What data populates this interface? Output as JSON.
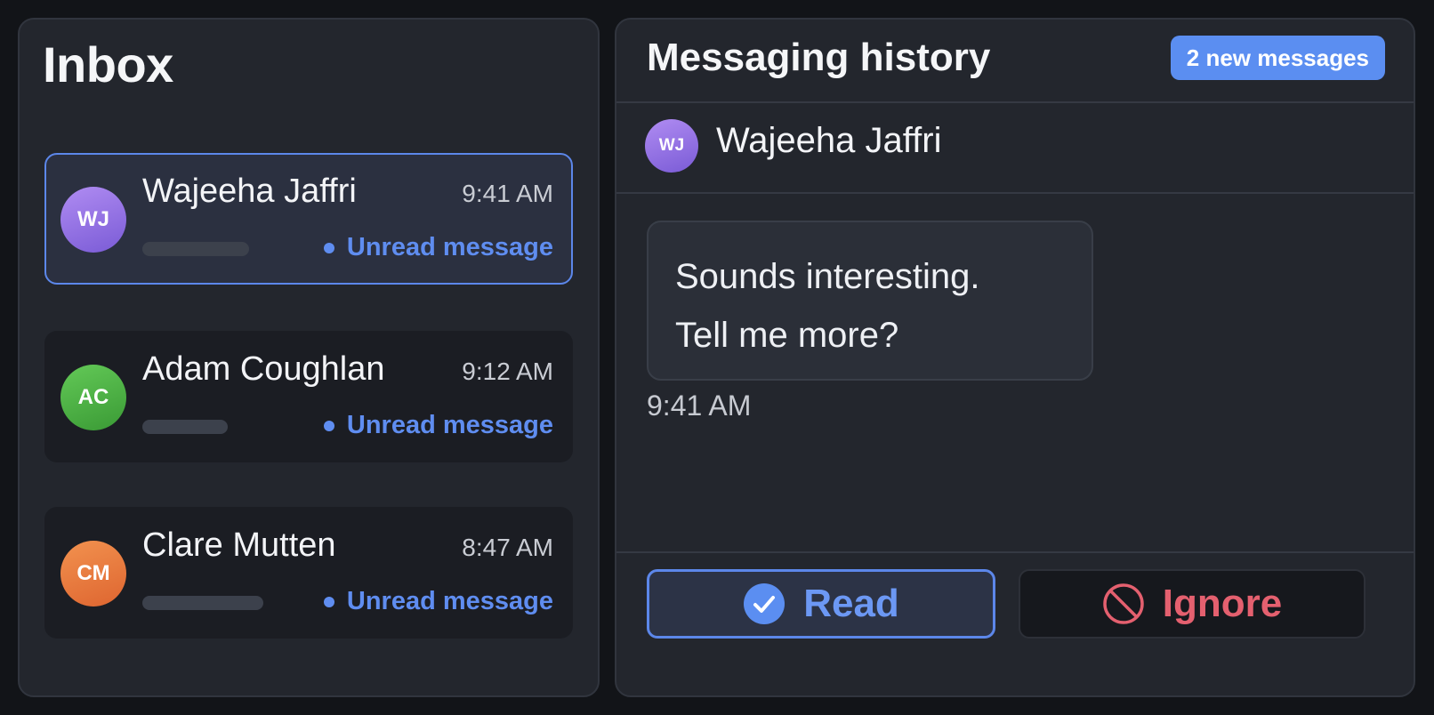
{
  "inbox": {
    "title": "Inbox",
    "threads": [
      {
        "initials": "WJ",
        "name": "Wajeeha Jaffri",
        "time": "9:41 AM",
        "status": "Unread message",
        "avatar_color": "#9370e0",
        "selected": true
      },
      {
        "initials": "AC",
        "name": "Adam Coughlan",
        "time": "9:12 AM",
        "status": "Unread message",
        "avatar_color": "#4caf45",
        "selected": false
      },
      {
        "initials": "CM",
        "name": "Clare Mutten",
        "time": "8:47 AM",
        "status": "Unread message",
        "avatar_color": "#ea7a41",
        "selected": false
      }
    ]
  },
  "history": {
    "title": "Messaging history",
    "badge": "2 new messages",
    "contact": {
      "initials": "WJ",
      "name": "Wajeeha Jaffri",
      "avatar_color": "#9370e0"
    },
    "message": {
      "line1": "Sounds interesting.",
      "line2": "Tell me more?",
      "time": "9:41 AM"
    },
    "actions": {
      "read_label": "Read",
      "ignore_label": "Ignore"
    }
  },
  "colors": {
    "accent": "#5b8ef1",
    "danger": "#e4606f",
    "panel": "#23262d"
  },
  "icons": {
    "read": "check-circle-icon",
    "ignore": "prohibit-icon",
    "unread": "dot-icon"
  }
}
